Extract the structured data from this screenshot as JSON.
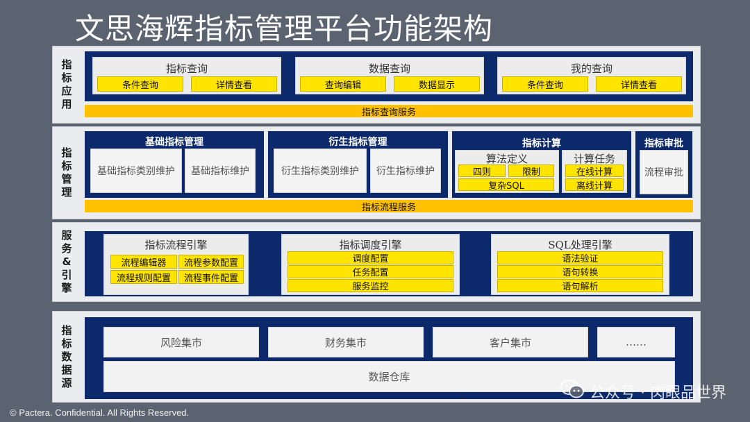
{
  "title": "文思海辉指标管理平台功能架构",
  "layers": {
    "app": {
      "label": [
        "指",
        "标",
        "应",
        "用"
      ],
      "modules": [
        {
          "title": "指标查询",
          "buttons": [
            "条件查询",
            "详情查看"
          ]
        },
        {
          "title": "数据查询",
          "buttons": [
            "查询编辑",
            "数据显示"
          ]
        },
        {
          "title": "我的查询",
          "buttons": [
            "条件查询",
            "详情查看"
          ]
        }
      ],
      "service": "指标查询服务"
    },
    "mgmt": {
      "label": [
        "指",
        "标",
        "管",
        "理"
      ],
      "basic": {
        "title": "基础指标管理",
        "items": [
          "基础指标类别维护",
          "基础指标维护"
        ]
      },
      "derived": {
        "title": "衍生指标管理",
        "items": [
          "衍生指标类别维护",
          "衍生指标维护"
        ]
      },
      "calc": {
        "title": "指标计算",
        "algo": {
          "title": "算法定义",
          "items": [
            "四则",
            "限制",
            "复杂SQL"
          ]
        },
        "task": {
          "title": "计算任务",
          "items": [
            "在线计算",
            "离线计算"
          ]
        }
      },
      "review": {
        "title": "指标审批",
        "item": "流程审批"
      },
      "service": "指标流程服务"
    },
    "engine": {
      "label": [
        "服",
        "务",
        "&",
        "引",
        "擎"
      ],
      "flow": {
        "title": "指标流程引擎",
        "items": [
          "流程编辑器",
          "流程参数配置",
          "流程规则配置",
          "流程事件配置"
        ]
      },
      "schedule": {
        "title": "指标调度引擎",
        "items": [
          "调度配置",
          "任务配置",
          "服务监控"
        ]
      },
      "sql": {
        "title": "SQL处理引擎",
        "items": [
          "语法验证",
          "语句转换",
          "语句解析"
        ]
      }
    },
    "data": {
      "label": [
        "指",
        "标",
        "数",
        "据",
        "源"
      ],
      "marts": [
        "风险集市",
        "财务集市",
        "客户集市",
        "……"
      ],
      "warehouse": "数据仓库",
      "ellipsis": "..."
    }
  },
  "watermark": {
    "text": "公众号 · 肉眼品世界",
    "icon": "wechat-icon"
  },
  "footer": "© Pactera. Confidential. All Rights Reserved.",
  "colors": {
    "background": "#5b6370",
    "navy": "#0c2a6b",
    "yellow": "#ffe400",
    "orange": "#ffc000",
    "panel": "#eaecef"
  }
}
